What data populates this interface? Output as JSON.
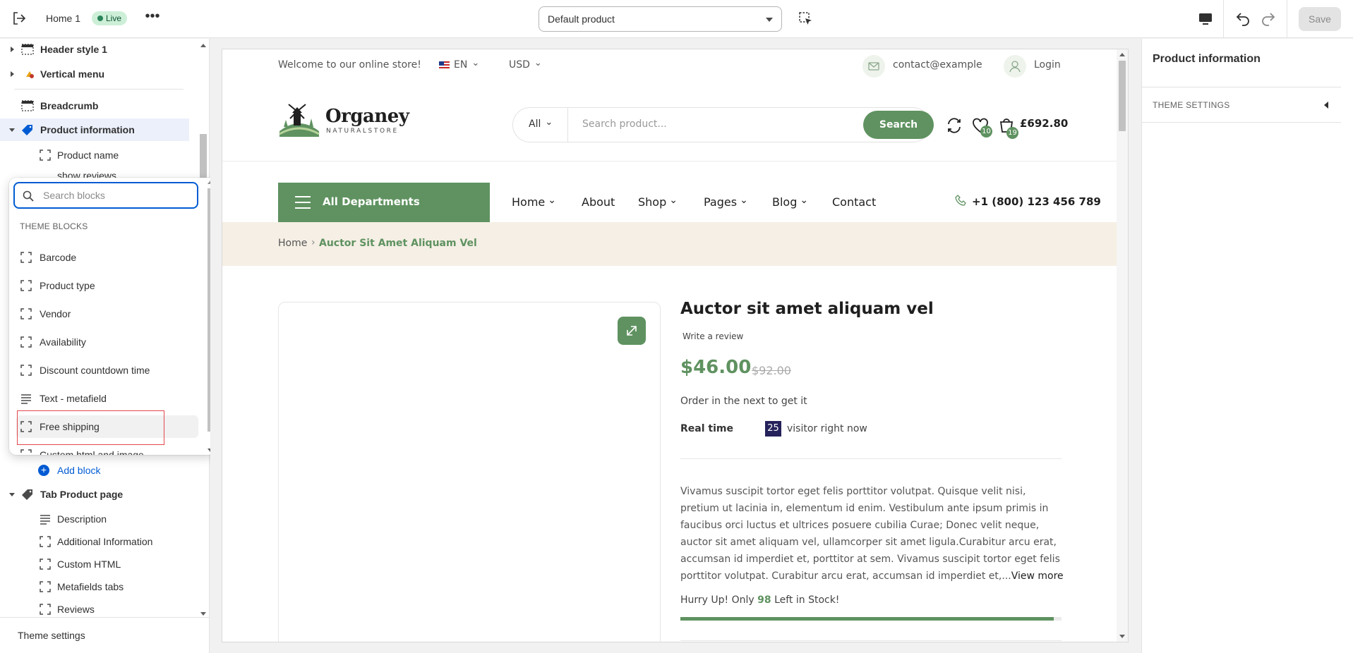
{
  "topbar": {
    "page_name": "Home 1",
    "live_label": "Live",
    "more_label": "•••",
    "template_select": "Default product",
    "save_label": "Save"
  },
  "sidebar": {
    "items": [
      {
        "label": "Header style 1"
      },
      {
        "label": "Vertical menu"
      },
      {
        "label": "Breadcrumb"
      },
      {
        "label": "Product information"
      },
      {
        "label": "Product name"
      },
      {
        "label": "show reviews"
      }
    ],
    "add_block_label": "Add block",
    "tab_section": {
      "label": "Tab Product page",
      "children": [
        "Description",
        "Additional Information",
        "Custom HTML",
        "Metafields tabs",
        "Reviews"
      ]
    },
    "theme_settings_label": "Theme settings"
  },
  "block_picker": {
    "search_placeholder": "Search blocks",
    "search_value": "",
    "category": "THEME BLOCKS",
    "options": [
      "Barcode",
      "Product type",
      "Vendor",
      "Availability",
      "Discount countdown time",
      "Text - metafield",
      "Free shipping",
      "Custom html and image"
    ],
    "hovered": "Free shipping"
  },
  "store": {
    "welcome": "Welcome to our online store!",
    "language": "EN",
    "currency": "USD",
    "contact": "contact@example",
    "login": "Login",
    "logo_name": "Organey",
    "logo_tag": "NATURALSTORE",
    "search_category": "All",
    "search_placeholder": "Search product...",
    "search_button": "Search",
    "wishlist_count": "10",
    "cart_count": "19",
    "cart_total": "£692.80",
    "departments": "All Departments",
    "nav": [
      "Home",
      "About",
      "Shop",
      "Pages",
      "Blog",
      "Contact"
    ],
    "phone": "+1 (800) 123 456 789",
    "breadcrumb_home": "Home",
    "breadcrumb_sep": "›",
    "breadcrumb_current": "Auctor Sit Amet Aliquam Vel",
    "product_title": "Auctor sit amet aliquam vel",
    "write_review": "Write a review",
    "price": "$46.00",
    "old_price": "$92.00",
    "order_text": "Order in the next to get it",
    "realtime_label": "Real time",
    "realtime_count": "25",
    "realtime_text": "visitor right now",
    "description": "Vivamus suscipit tortor eget felis porttitor volutpat. Quisque velit nisi, pretium ut lacinia in, elementum id enim. Vestibulum ante ipsum primis in faucibus orci luctus et ultrices posuere cubilia Curae; Donec velit neque, auctor sit amet aliquam vel, ullamcorper sit amet ligula.Curabitur arcu erat, accumsan id imperdiet et, porttitor at sem. Vivamus suscipit tortor eget felis porttitor volutpat. Curabitur arcu erat, accumsan id imperdiet et,...",
    "view_more": "View more",
    "stock_prefix": "Hurry Up! Only",
    "stock_count": "98",
    "stock_suffix": "Left in Stock!",
    "stock_fraction": 0.98
  },
  "right_panel": {
    "title": "Product information",
    "section": "THEME SETTINGS"
  },
  "colors": {
    "brand_green": "#5f9260",
    "selection_blue": "#005bd3",
    "highlight_red": "#e5484d"
  }
}
